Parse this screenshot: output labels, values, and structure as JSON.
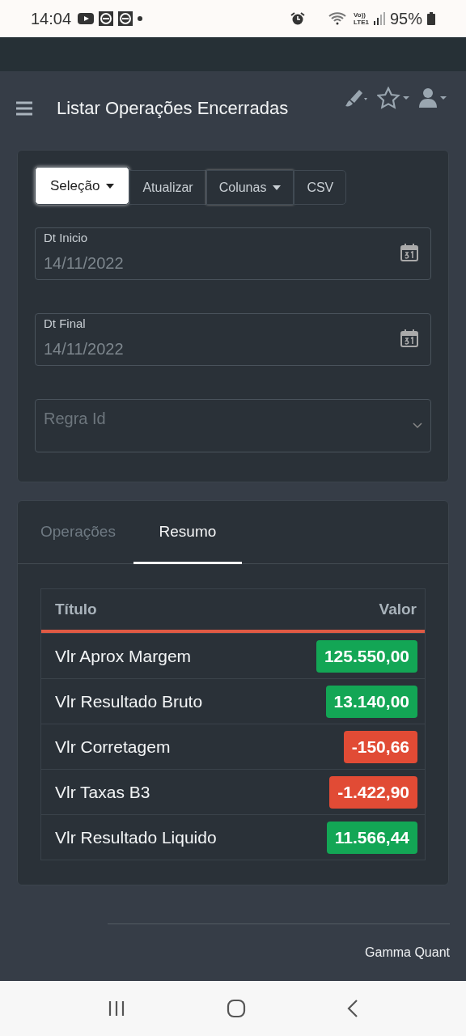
{
  "status_bar": {
    "time": "14:04",
    "network": "Vo))\nLTE1",
    "battery": "95%"
  },
  "header": {
    "title": "Listar Operações Encerradas"
  },
  "toolbar": {
    "buttons": [
      {
        "label": "Seleção",
        "kind": "dropdown",
        "selected": true
      },
      {
        "label": "Atualizar",
        "kind": "plain",
        "selected": false
      },
      {
        "label": "Colunas",
        "kind": "dropdown",
        "selected": false
      },
      {
        "label": "CSV",
        "kind": "plain",
        "selected": false
      }
    ]
  },
  "fields": [
    {
      "label": "Dt Inicio",
      "value": "14/11/2022",
      "kind": "date"
    },
    {
      "label": "Dt Final",
      "value": "14/11/2022",
      "kind": "date"
    },
    {
      "placeholder": "Regra Id",
      "kind": "select"
    }
  ],
  "tabs": [
    {
      "label": "Operações",
      "selected": false
    },
    {
      "label": "Resumo",
      "selected": true
    }
  ],
  "table": {
    "columns": [
      "Título",
      "Valor"
    ],
    "rows": [
      {
        "title": "Vlr Aprox Margem",
        "value": "125.550,00",
        "color": "#13a655"
      },
      {
        "title": "Vlr Resultado Bruto",
        "value": "13.140,00",
        "color": "#13a655"
      },
      {
        "title": "Vlr Corretagem",
        "value": "-150,66",
        "color": "#e14b35"
      },
      {
        "title": "Vlr Taxas B3",
        "value": "-1.422,90",
        "color": "#e14b35"
      },
      {
        "title": "Vlr Resultado Liquido",
        "value": "11.566,44",
        "color": "#13a655"
      }
    ]
  },
  "footer": {
    "text": "Gamma Quant"
  }
}
